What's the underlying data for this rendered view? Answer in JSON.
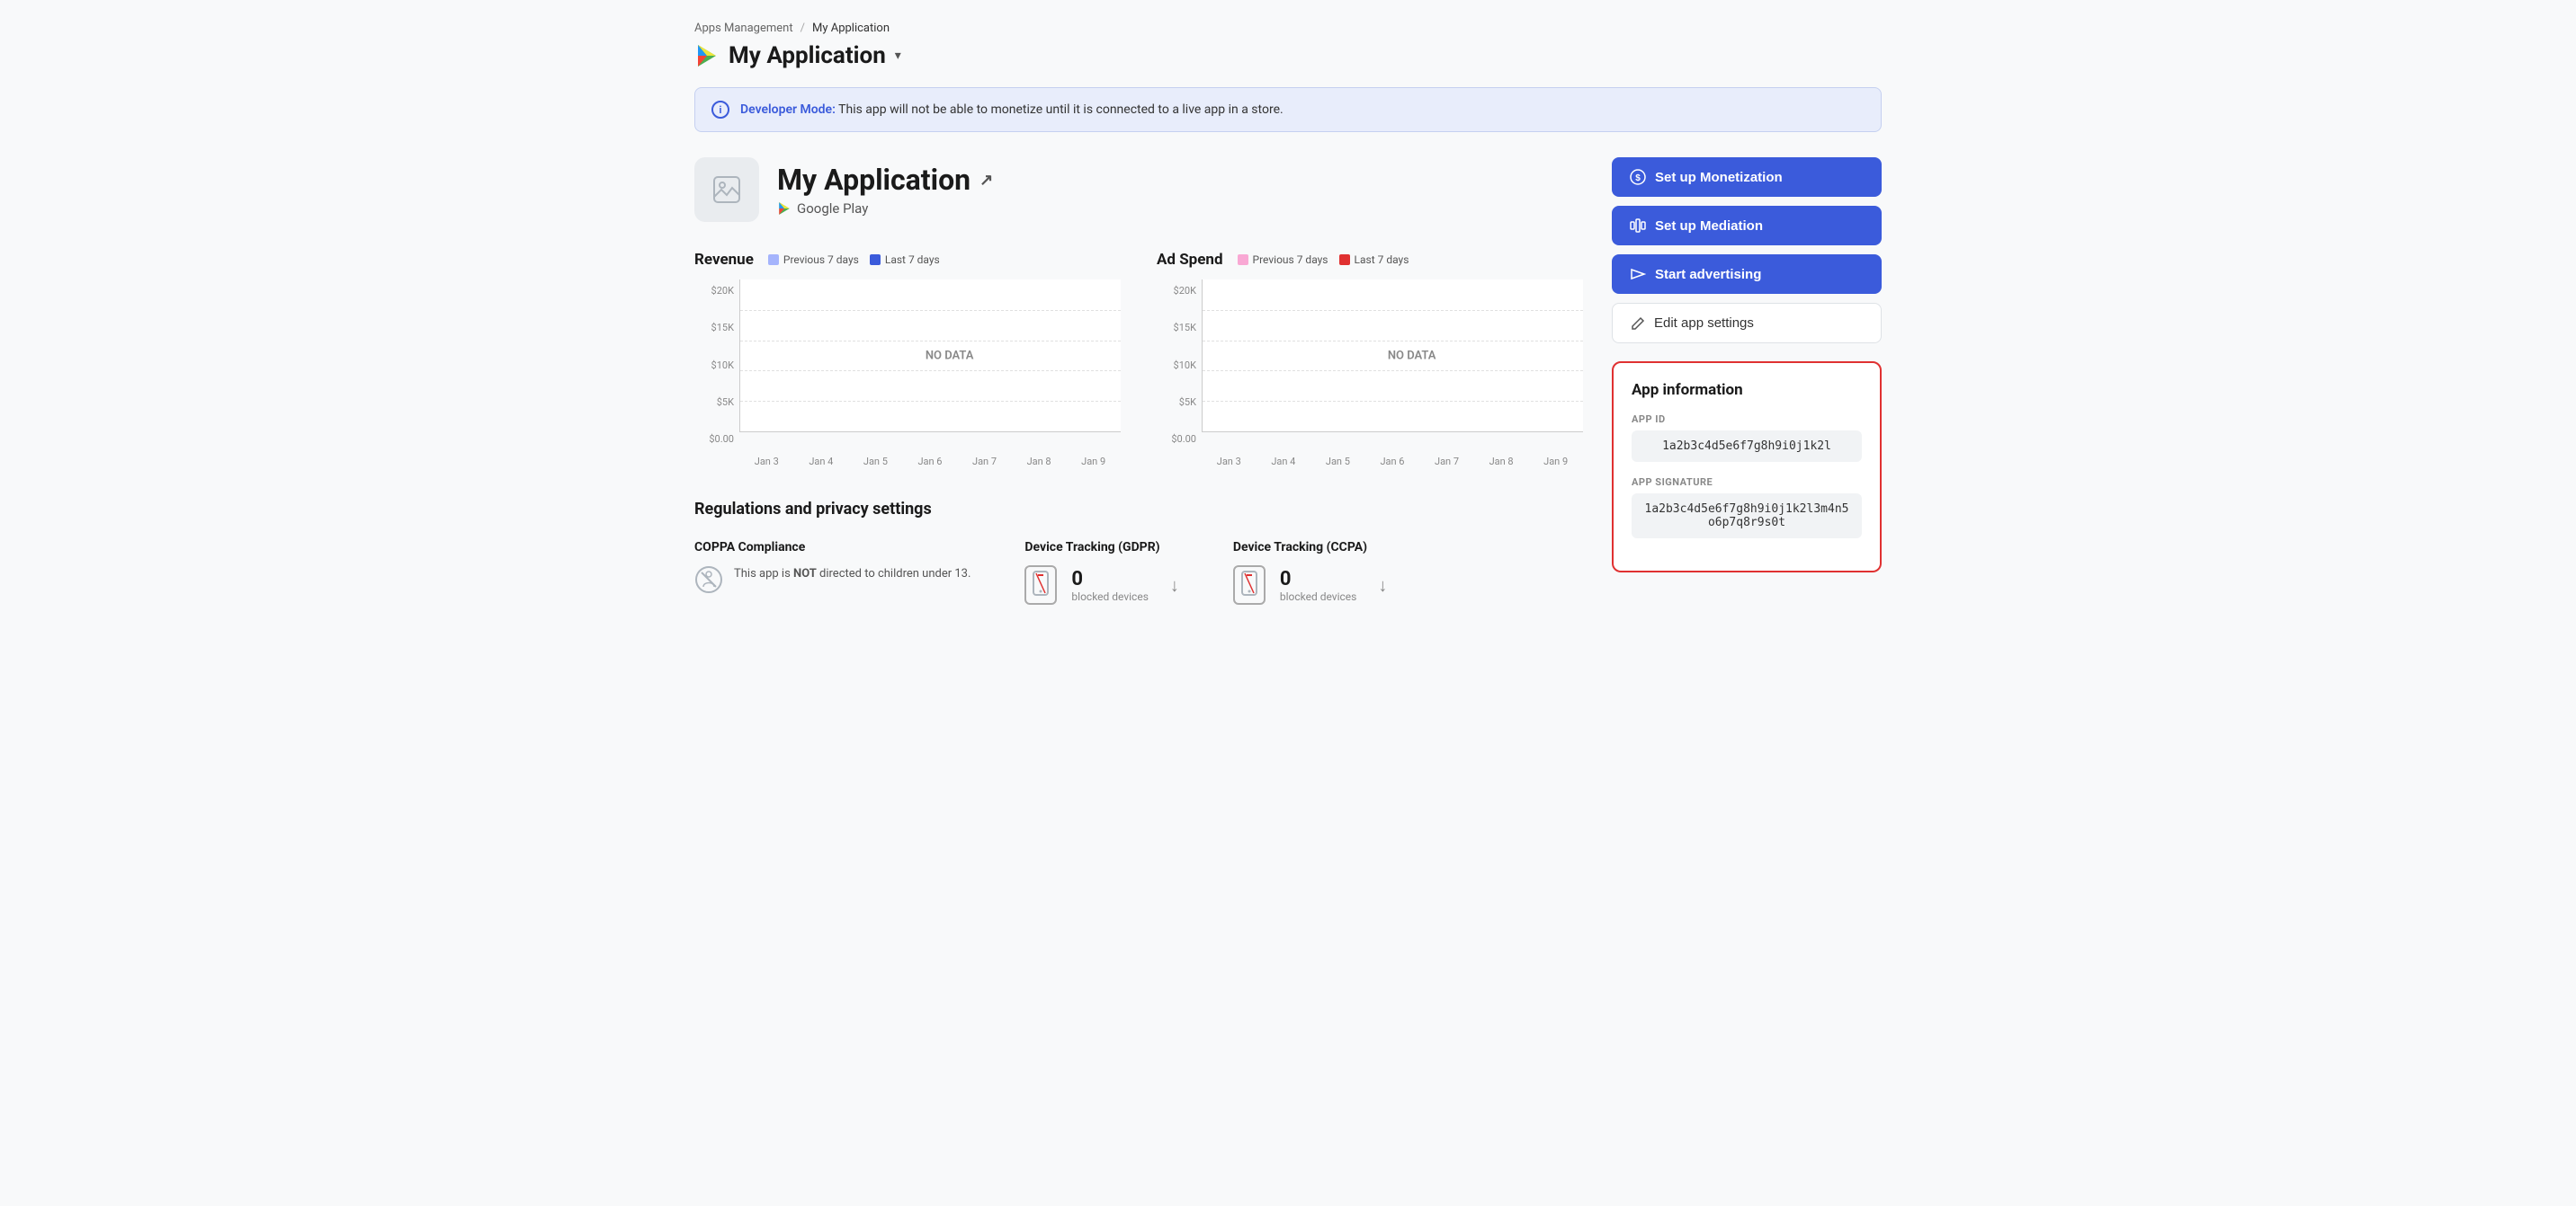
{
  "breadcrumb": {
    "parent": "Apps Management",
    "separator": "/",
    "current": "My Application"
  },
  "appTitle": {
    "name": "My Application",
    "chevron": "▾"
  },
  "devModeBanner": {
    "label": "Developer Mode:",
    "text": " This app will not be able to monetize until it is connected to a live app in a store."
  },
  "appHeader": {
    "name": "My Application",
    "platform": "Google Play"
  },
  "revenueChart": {
    "title": "Revenue",
    "legend": {
      "prev": "Previous 7 days",
      "last": "Last 7 days",
      "prevColor": "#a5b4fc",
      "lastColor": "#3b5bdb"
    },
    "yLabels": [
      "$20K",
      "$15K",
      "$10K",
      "$5K",
      "$0.00"
    ],
    "xLabels": [
      "Jan 3",
      "Jan 4",
      "Jan 5",
      "Jan 6",
      "Jan 7",
      "Jan 8",
      "Jan 9"
    ],
    "noData": "NO DATA"
  },
  "adSpendChart": {
    "title": "Ad Spend",
    "legend": {
      "prev": "Previous 7 days",
      "last": "Last 7 days",
      "prevColor": "#f9a8d4",
      "lastColor": "#e03131"
    },
    "yLabels": [
      "$20K",
      "$15K",
      "$10K",
      "$5K",
      "$0.00"
    ],
    "xLabels": [
      "Jan 3",
      "Jan 4",
      "Jan 5",
      "Jan 6",
      "Jan 7",
      "Jan 8",
      "Jan 9"
    ],
    "noData": "NO DATA"
  },
  "buttons": {
    "monetization": "Set up Monetization",
    "mediation": "Set up Mediation",
    "advertising": "Start advertising",
    "editSettings": "Edit app settings"
  },
  "appInfo": {
    "title": "App information",
    "appIdLabel": "APP ID",
    "appIdValue": "1a2b3c4d5e6f7g8h9i0j1k2l",
    "appSigLabel": "APP SIGNATURE",
    "appSigValue": "1a2b3c4d5e6f7g8h9i0j1k2l3m4n5o6p7q8r9s0t"
  },
  "privacySection": {
    "title": "Regulations and privacy settings",
    "coppa": {
      "title": "COPPA Compliance",
      "text": "This app is NOT directed to children under 13."
    },
    "gdpr": {
      "title": "Device Tracking (GDPR)",
      "count": "0",
      "label": "blocked devices"
    },
    "ccpa": {
      "title": "Device Tracking (CCPA)",
      "count": "0",
      "label": "blocked devices"
    }
  }
}
